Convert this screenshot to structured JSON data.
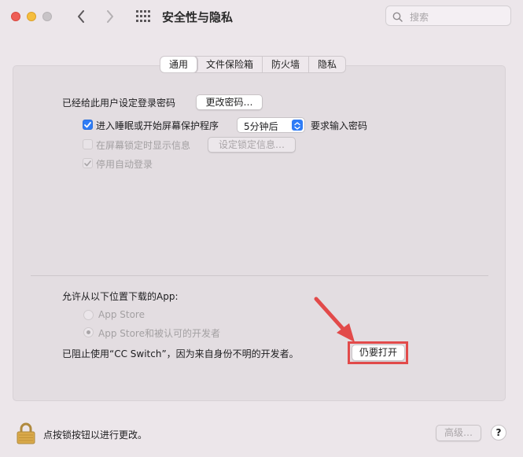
{
  "window": {
    "title": "安全性与隐私"
  },
  "search": {
    "placeholder": "搜索"
  },
  "tabs": [
    {
      "label": "通用",
      "active": true
    },
    {
      "label": "文件保险箱",
      "active": false
    },
    {
      "label": "防火墙",
      "active": false
    },
    {
      "label": "隐私",
      "active": false
    }
  ],
  "general": {
    "password_text": "已经给此用户设定登录密码",
    "change_password_button": "更改密码…",
    "sleep_checkbox_label": "进入睡眠或开始屏幕保护程序",
    "sleep_checkbox_checked": true,
    "sleep_delay_value": "5分钟后",
    "require_password_text": "要求输入密码",
    "lock_message_label": "在屏幕锁定时显示信息",
    "lock_message_button": "设定锁定信息…",
    "auto_login_label": "停用自动登录"
  },
  "downloads": {
    "heading": "允许从以下位置下载的App:",
    "option_app_store": "App Store",
    "option_identified": "App Store和被认可的开发者",
    "selected": "option_identified",
    "blocked_message": "已阻止使用“CC Switch”，因为来自身份不明的开发者。",
    "open_anyway_button": "仍要打开"
  },
  "footer": {
    "lock_text": "点按锁按钮以进行更改。",
    "advanced_button": "高级…",
    "help_button": "?"
  },
  "colors": {
    "accent": "#2f7cf6",
    "annotation_red": "#e24a4a"
  }
}
